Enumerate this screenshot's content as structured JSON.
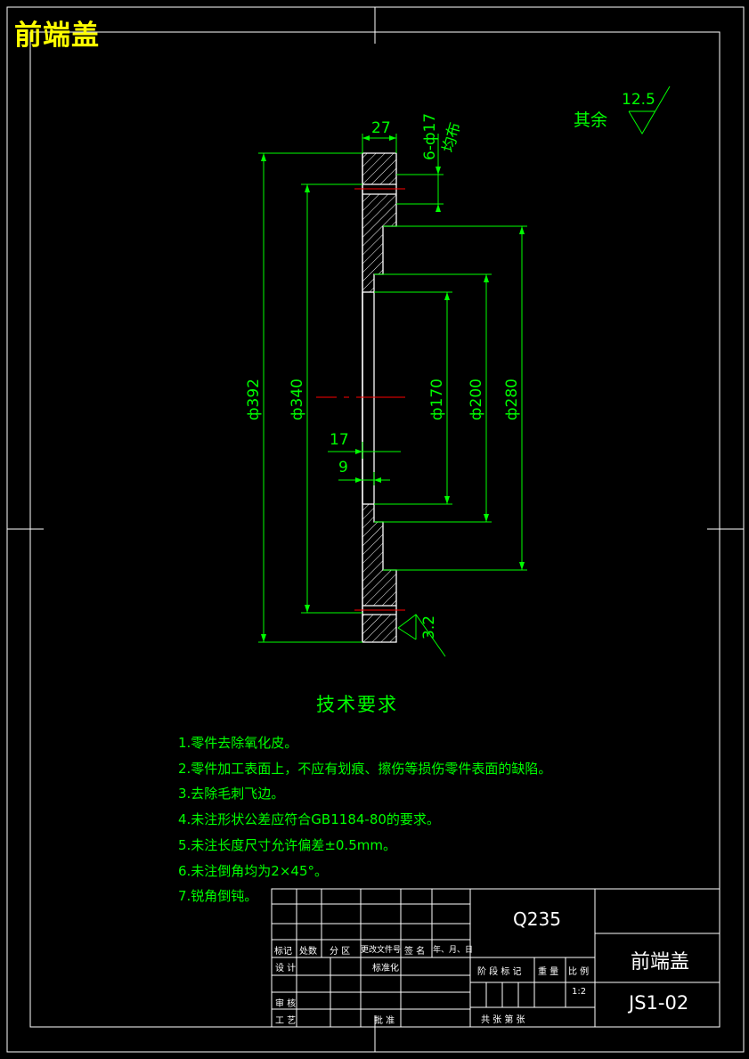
{
  "drawing_title": "前端盖",
  "roughness_note": {
    "label": "其余",
    "value": "12.5"
  },
  "hole_note": {
    "count": "6-ф17",
    "pattern": "均布"
  },
  "dimensions": {
    "width_27": "27",
    "dia_392": "ф392",
    "dia_340": "ф340",
    "dia_170": "ф170",
    "dia_200": "ф200",
    "dia_280": "ф280",
    "len_17": "17",
    "len_9": "9",
    "roughness_32": "3.2"
  },
  "technical_requirements": {
    "heading": "技术要求",
    "items": [
      "1.零件去除氧化皮。",
      "2.零件加工表面上，不应有划痕、擦伤等损伤零件表面的缺陷。",
      "3.去除毛刺飞边。",
      "4.未注形状公差应符合GB1184-80的要求。",
      "5.未注长度尺寸允许偏差±0.5mm。",
      "6.未注倒角均为2×45°。",
      "7.锐角倒钝。"
    ]
  },
  "title_block": {
    "material": "Q235",
    "part_name": "前端盖",
    "drawing_number": "JS1-02",
    "scale": "1:2",
    "headers": [
      "标记",
      "处数",
      "分 区",
      "更改文件号",
      "签 名",
      "年、月、日"
    ],
    "design": "设 计",
    "standardization": "标准化",
    "review": "审 核",
    "process": "工 艺",
    "approve": "批 准",
    "stage_mark": "阶 段 标 记",
    "weight": "重 量",
    "ratio": "比 例",
    "sheets": "共   张  第   张"
  },
  "colors": {
    "frame": "#ffffff",
    "dimension": "#00ff00",
    "title": "#ffff00",
    "centerline": "#ff0000"
  }
}
